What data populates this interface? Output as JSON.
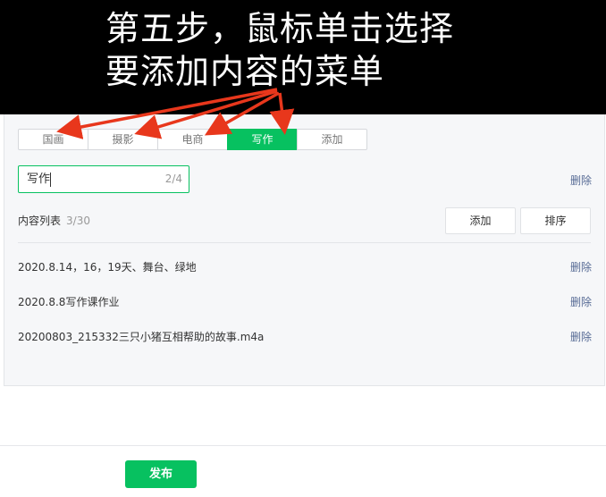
{
  "banner": {
    "line1": "第五步，鼠标单击选择",
    "line2": "要添加内容的菜单"
  },
  "tabs": [
    {
      "label": "国画",
      "active": false
    },
    {
      "label": "摄影",
      "active": false
    },
    {
      "label": "电商",
      "active": false
    },
    {
      "label": "写作",
      "active": true
    },
    {
      "label": "添加",
      "active": false
    }
  ],
  "menu_name": {
    "value": "写作",
    "count": "2/4",
    "delete_label": "删除"
  },
  "content_list": {
    "title": "内容列表",
    "count": "3/30",
    "add_label": "添加",
    "sort_label": "排序",
    "items": [
      {
        "title": "2020.8.14，16，19天、舞台、绿地",
        "delete_label": "删除"
      },
      {
        "title": "2020.8.8写作课作业",
        "delete_label": "删除"
      },
      {
        "title": "20200803_215332三只小猪互相帮助的故事.m4a",
        "delete_label": "删除"
      }
    ]
  },
  "footer": {
    "publish_label": "发布"
  },
  "colors": {
    "accent": "#07c160",
    "annotation_arrow": "#e8371c",
    "link": "#576b95"
  }
}
